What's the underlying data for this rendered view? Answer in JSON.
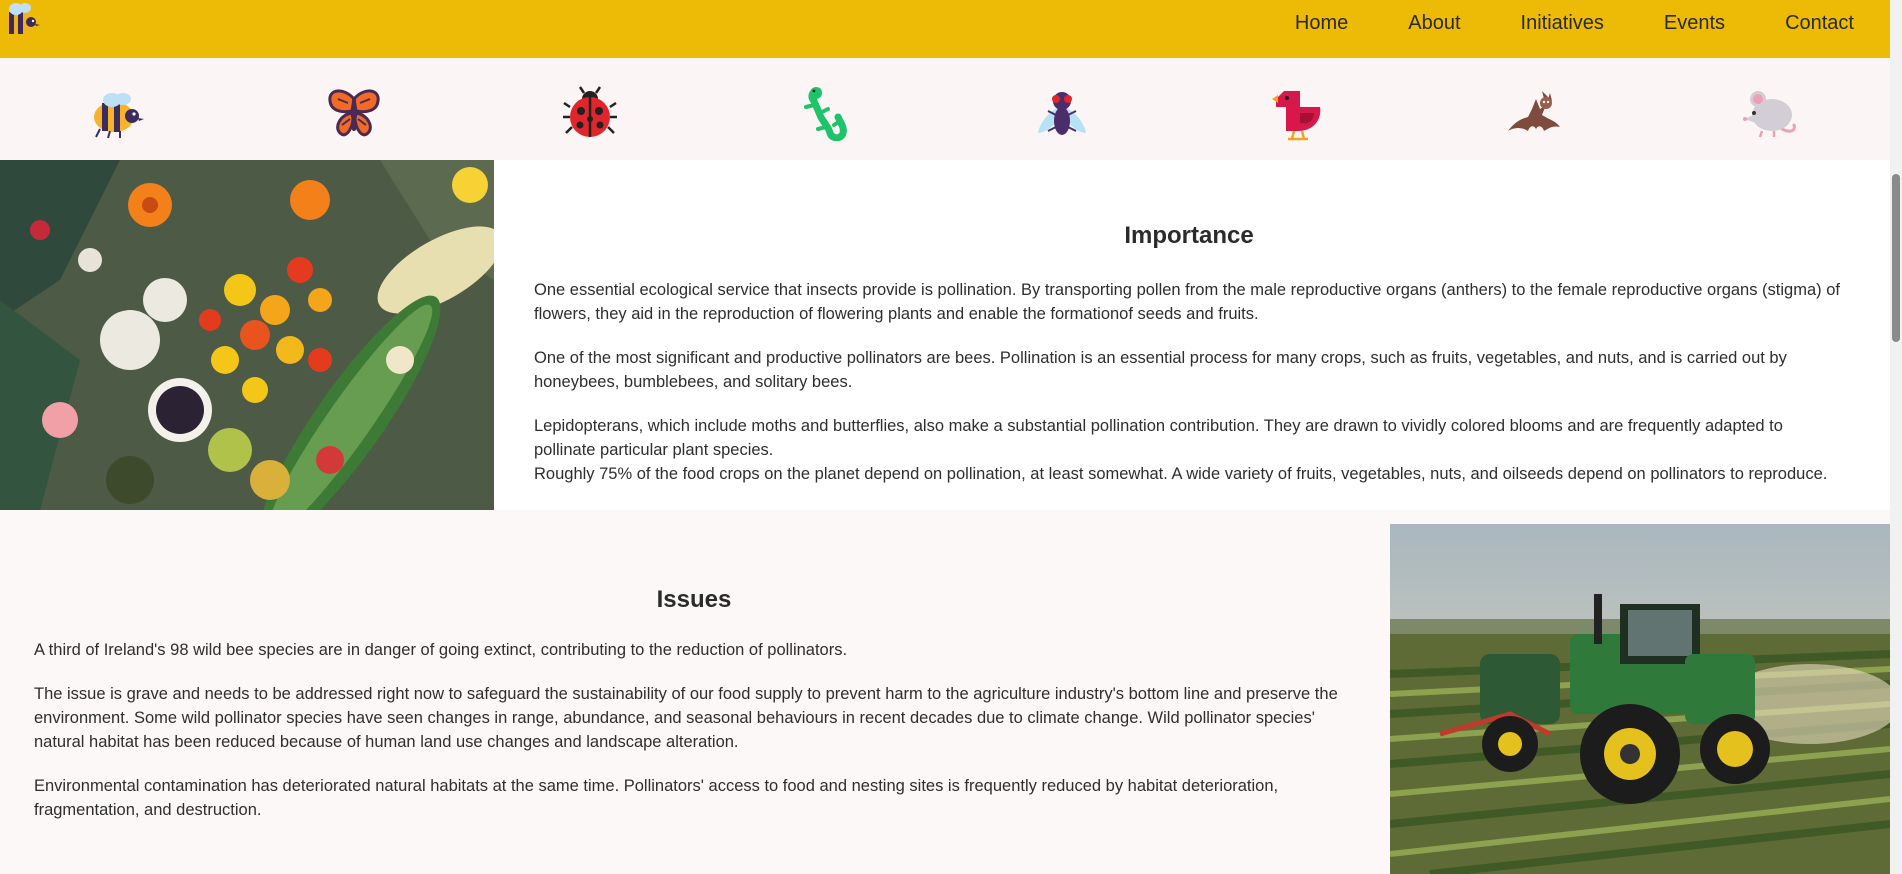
{
  "nav": {
    "links": [
      {
        "label": "Home"
      },
      {
        "label": "About"
      },
      {
        "label": "Initiatives"
      },
      {
        "label": "Events"
      },
      {
        "label": "Contact"
      }
    ]
  },
  "pollinator_icons": [
    "bee-icon",
    "butterfly-icon",
    "ladybug-icon",
    "lizard-icon",
    "fly-icon",
    "bird-icon",
    "bat-icon",
    "mouse-icon"
  ],
  "importance": {
    "title": "Importance",
    "paragraphs": [
      "One essential ecological service that insects provide is pollination. By transporting pollen from the male reproductive organs (anthers) to the female reproductive organs (stigma) of flowers, they aid in the reproduction of flowering plants and enable the formationof seeds and fruits.",
      "One of the most significant and productive pollinators are bees. Pollination is an essential process for many crops, such as fruits, vegetables, and nuts, and is carried out by honeybees, bumblebees, and solitary bees.",
      "Lepidopterans, which include moths and butterflies, also make a substantial pollination contribution. They are drawn to vividly colored blooms and are frequently adapted to pollinate particular plant species.",
      "Roughly 75% of the food crops on the planet depend on pollination, at least somewhat. A wide variety of fruits, vegetables, nuts, and oilseeds depend on pollinators to reproduce."
    ]
  },
  "issues": {
    "title": "Issues",
    "paragraphs": [
      "A third of Ireland's 98 wild bee species are in danger of going extinct, contributing to the reduction of pollinators.",
      "The issue is grave and needs to be addressed right now to safeguard the sustainability of our food supply to prevent harm to the agriculture industry's bottom line and preserve the environment. Some wild pollinator species have seen changes in range, abundance, and seasonal behaviours in recent decades due to climate change. Wild pollinator species' natural habitat has been reduced because of human land use changes and landscape alteration.",
      "Environmental contamination has deteriorated natural habitats at the same time. Pollinators' access to food and nesting sites is frequently reduced by habitat deterioration, fragmentation, and destruction."
    ]
  },
  "colors": {
    "navbar": "#edba06",
    "background": "#fcf8f7",
    "text": "#2b2b2b"
  }
}
